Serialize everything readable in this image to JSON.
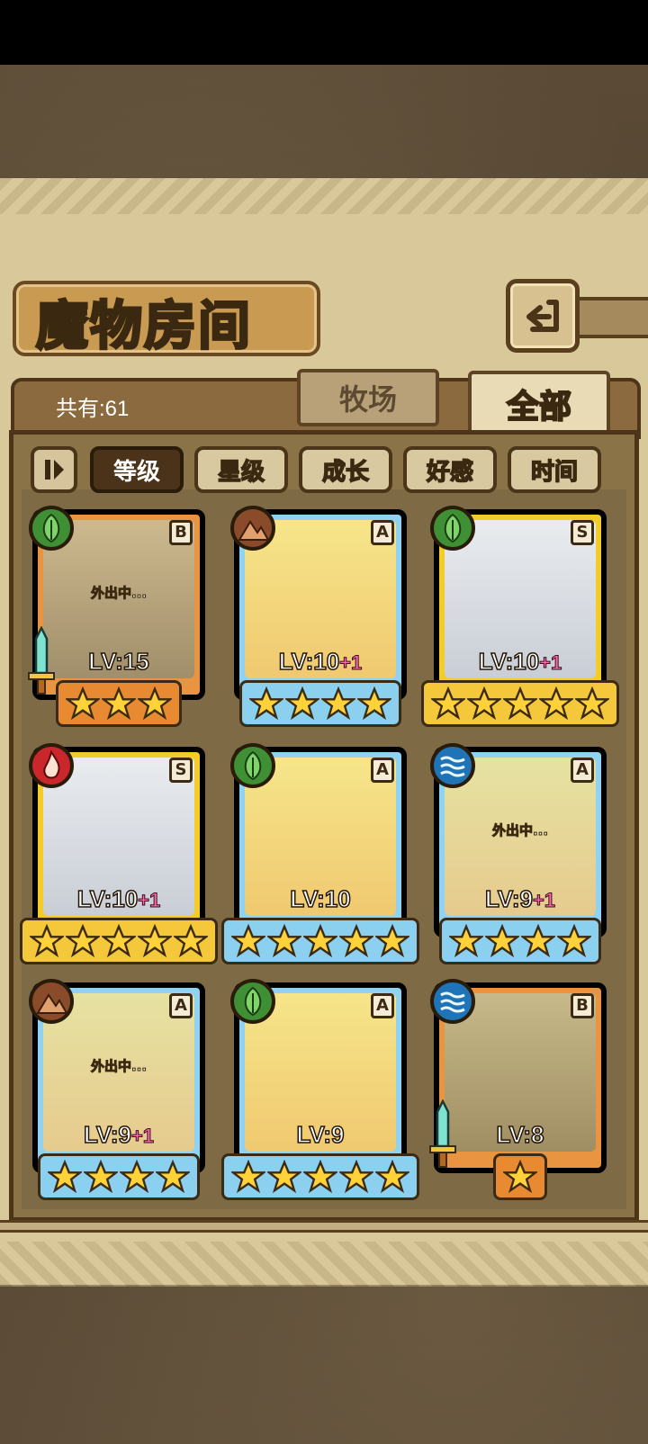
{
  "header": {
    "title": "魔物房间",
    "back_icon": "back-return-icon"
  },
  "summary": {
    "count_label": "共有:61"
  },
  "tabs": [
    {
      "label": "牧场",
      "active": false
    },
    {
      "label": "全部",
      "active": true
    }
  ],
  "sort": {
    "toggle_icon": "pause-toggle-icon",
    "buttons": [
      {
        "label": "等级",
        "active": true
      },
      {
        "label": "星级",
        "active": false
      },
      {
        "label": "成长",
        "active": false
      },
      {
        "label": "好感",
        "active": false
      },
      {
        "label": "时间",
        "active": false
      }
    ]
  },
  "monsters": [
    {
      "rank": "B",
      "element": "leaf-icon",
      "frame": "orange",
      "level": "LV:15",
      "bonus": "",
      "stars": 3,
      "status": "外出中...",
      "weapon": true
    },
    {
      "rank": "A",
      "element": "mountain-icon",
      "frame": "blue",
      "level": "LV:10",
      "bonus": "+1",
      "stars": 4,
      "status": "",
      "weapon": false
    },
    {
      "rank": "S",
      "element": "leaf-icon",
      "frame": "gold",
      "level": "LV:10",
      "bonus": "+1",
      "stars": 5,
      "status": "",
      "weapon": false
    },
    {
      "rank": "S",
      "element": "flame-icon",
      "frame": "gold",
      "level": "LV:10",
      "bonus": "+1",
      "stars": 5,
      "status": "",
      "weapon": false
    },
    {
      "rank": "A",
      "element": "leaf-icon",
      "frame": "blue",
      "level": "LV:10",
      "bonus": "",
      "stars": 5,
      "status": "",
      "weapon": false
    },
    {
      "rank": "A",
      "element": "water-icon",
      "frame": "blue",
      "level": "LV:9",
      "bonus": "+1",
      "stars": 4,
      "status": "外出中...",
      "weapon": false
    },
    {
      "rank": "A",
      "element": "mountain-icon",
      "frame": "blue",
      "level": "LV:9",
      "bonus": "+1",
      "stars": 4,
      "status": "外出中...",
      "weapon": false
    },
    {
      "rank": "A",
      "element": "leaf-icon",
      "frame": "blue",
      "level": "LV:9",
      "bonus": "",
      "stars": 5,
      "status": "",
      "weapon": false
    },
    {
      "rank": "B",
      "element": "water-icon",
      "frame": "orange",
      "level": "LV:8",
      "bonus": "",
      "stars": 1,
      "status": "",
      "weapon": true
    }
  ],
  "colors": {
    "panel": "#d8c89a",
    "frame_orange": "#e99440",
    "frame_blue": "#8fd2f2",
    "frame_gold": "#f4cc2a",
    "star": "#ffd23a",
    "bonus": "#ff6aa8"
  }
}
